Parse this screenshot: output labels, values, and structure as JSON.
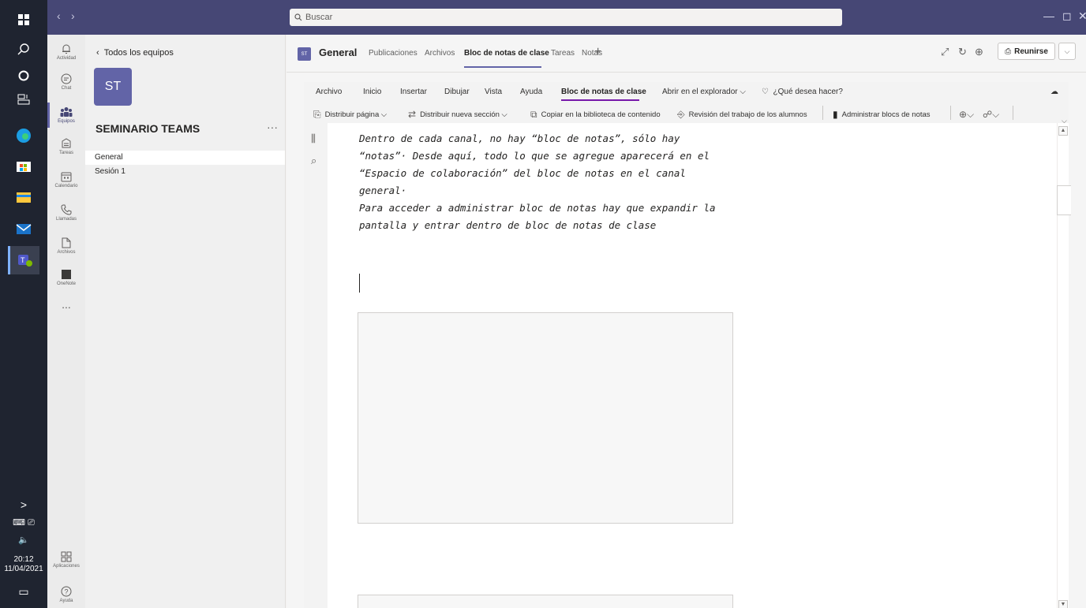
{
  "taskbar": {
    "clock_time": "20:12",
    "clock_date": "11/04/2021"
  },
  "titlebar": {
    "search_placeholder": "Buscar"
  },
  "app_bar": {
    "items": [
      {
        "label": "Actividad",
        "icon": "bell-icon"
      },
      {
        "label": "Chat",
        "icon": "chat-icon"
      },
      {
        "label": "Equipos",
        "icon": "teams-icon"
      },
      {
        "label": "Tareas",
        "icon": "assignments-icon"
      },
      {
        "label": "Calendario",
        "icon": "calendar-icon"
      },
      {
        "label": "Llamadas",
        "icon": "phone-icon"
      },
      {
        "label": "Archivos",
        "icon": "file-icon"
      },
      {
        "label": "OneNote",
        "icon": "onenote-icon"
      }
    ],
    "more": "...",
    "apps_label": "Aplicaciones",
    "help_label": "Ayuda"
  },
  "team_panel": {
    "back_label": "Todos los equipos",
    "team_initials": "ST",
    "team_name": "SEMINARIO TEAMS",
    "more": "···",
    "channels": [
      {
        "name": "General",
        "selected": true
      },
      {
        "name": "Sesión 1",
        "selected": false
      }
    ]
  },
  "channel_header": {
    "avatar": "ST",
    "title": "General",
    "tabs": [
      {
        "label": "Publicaciones",
        "active": false
      },
      {
        "label": "Archivos",
        "active": false
      },
      {
        "label": "Bloc de notas de clase",
        "active": true
      },
      {
        "label": "Tareas",
        "active": false
      },
      {
        "label": "Notas",
        "active": false
      }
    ],
    "add_tab": "+",
    "join_label": "Reunirse"
  },
  "ribbon": {
    "tabs": [
      {
        "label": "Archivo",
        "active": false
      },
      {
        "label": "Inicio",
        "active": false
      },
      {
        "label": "Insertar",
        "active": false
      },
      {
        "label": "Dibujar",
        "active": false
      },
      {
        "label": "Vista",
        "active": false
      },
      {
        "label": "Ayuda",
        "active": false
      },
      {
        "label": "Bloc de notas de clase",
        "active": true
      },
      {
        "label": "Abrir en el explorador ⌵",
        "active": false
      }
    ],
    "tell_me": "¿Qué desea hacer?",
    "commands": [
      "Distribuir página ⌵",
      "Distribuir nueva sección ⌵",
      "Copiar en la biblioteca de contenido",
      "Revisión del trabajo de los alumnos",
      "Administrar blocs de notas"
    ]
  },
  "note": {
    "lines": [
      "Dentro de cada canal, no hay “bloc de notas”, sólo hay",
      "“notas”· Desde aquí, todo lo que se agregue aparecerá en el",
      "“Espacio de colaboración” del bloc de notas en el canal",
      "general·",
      "Para acceder a administrar bloc de notas hay que expandir la",
      "pantalla y entrar dentro de bloc de notas de clase"
    ]
  }
}
